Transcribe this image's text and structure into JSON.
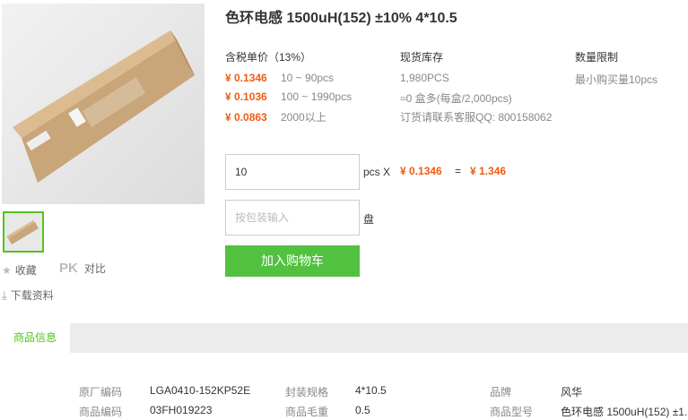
{
  "product": {
    "title": "色环电感 1500uH(152) ±10% 4*10.5"
  },
  "pricing": {
    "header": "含税单价（13%）",
    "tiers": [
      {
        "price": "¥ 0.1346",
        "range": "10 ~ 90pcs"
      },
      {
        "price": "¥ 0.1036",
        "range": "100 ~ 1990pcs"
      },
      {
        "price": "¥ 0.0863",
        "range": "2000以上"
      }
    ]
  },
  "stock": {
    "header": "现货库存",
    "quantity": "1,980PCS",
    "boxes": "≈0 盒多(每盒/2,000pcs)",
    "contact": "订货请联系客服QQ: 800158062"
  },
  "limit": {
    "header": "数量限制",
    "value": "最小购买量10pcs"
  },
  "order": {
    "quantity_value": "10",
    "pcs_label": "pcs X",
    "unit_price": "¥ 0.1346",
    "equals": "=",
    "total": "¥ 1.346",
    "pack_placeholder": "按包装输入",
    "pack_unit": "盘",
    "add_to_cart": "加入购物车"
  },
  "actions": {
    "favorite": "收藏",
    "pk_badge": "PK",
    "compare": "对比",
    "download": "下载资料"
  },
  "tabs": [
    {
      "label": "商品信息",
      "active": true
    }
  ],
  "specs": [
    {
      "key": "原厂编码",
      "value": "LGA0410-152KP52E"
    },
    {
      "key": "封装规格",
      "value": "4*10.5"
    },
    {
      "key": "品牌",
      "value": "风华"
    },
    {
      "key": "商品编码",
      "value": "03FH019223"
    },
    {
      "key": "商品毛重",
      "value": "0.5"
    },
    {
      "key": "商品型号",
      "value": "色环电感 1500uH(152) ±1..."
    }
  ],
  "colors": {
    "accent_green": "#53c140",
    "price_orange": "#f25b11"
  },
  "icons": [
    "star-icon",
    "pk-icon",
    "download-icon"
  ]
}
